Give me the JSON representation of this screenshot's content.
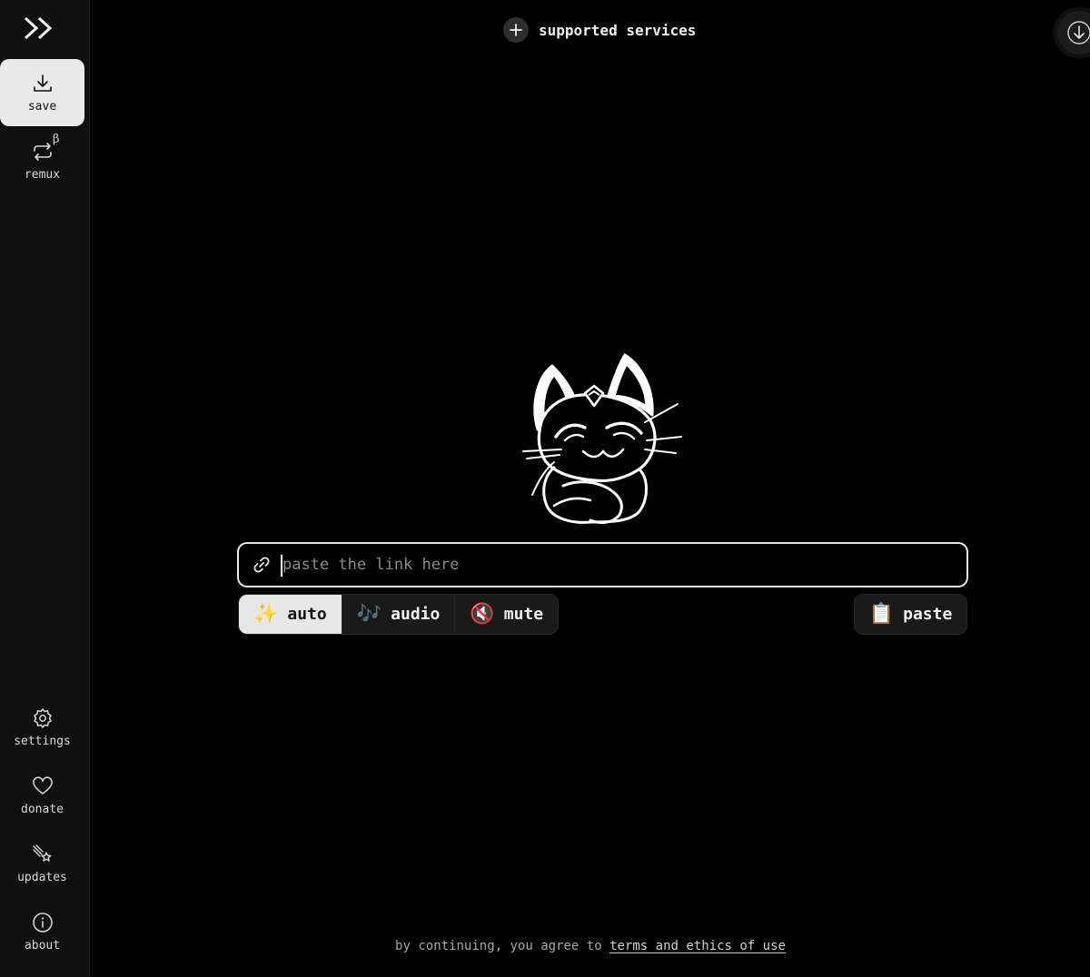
{
  "sidebar": {
    "logo": "cobalt-logo",
    "items": [
      {
        "label": "save",
        "icon": "download-icon",
        "active": true
      },
      {
        "label": "remux",
        "icon": "repeat-icon",
        "badge": "β"
      }
    ],
    "bottom_items": [
      {
        "label": "settings",
        "icon": "gear-icon"
      },
      {
        "label": "donate",
        "icon": "heart-icon"
      },
      {
        "label": "updates",
        "icon": "comet-icon"
      },
      {
        "label": "about",
        "icon": "info-icon"
      }
    ]
  },
  "header": {
    "services_label": "supported services"
  },
  "main": {
    "link_input": {
      "placeholder": "paste the link here",
      "value": ""
    },
    "modes": [
      {
        "label": "auto",
        "emoji": "✨",
        "active": true
      },
      {
        "label": "audio",
        "emoji": "🎶"
      },
      {
        "label": "mute",
        "emoji": "🔇"
      }
    ],
    "paste": {
      "label": "paste",
      "emoji": "📋"
    }
  },
  "footer": {
    "text": "by continuing, you agree to ",
    "link": "terms and ethics of use"
  },
  "colors": {
    "background": "#000000",
    "sidebar": "#101010",
    "active_item": "#e9e9e9",
    "button": "#1a1a1a"
  }
}
